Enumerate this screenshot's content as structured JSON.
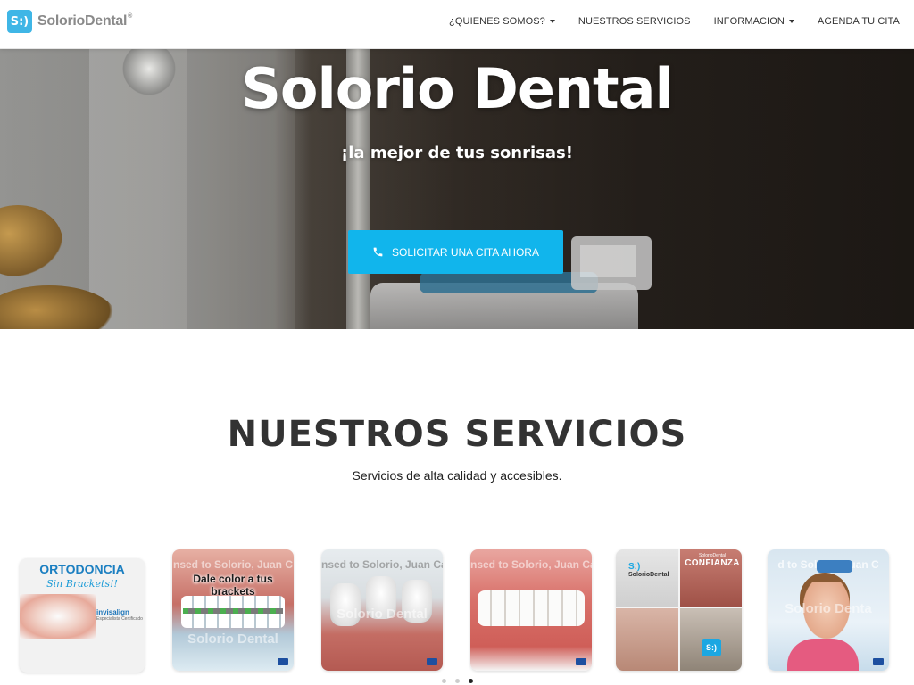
{
  "brand": {
    "mark": "S:)",
    "name": "SolorioDental",
    "trademark": "®"
  },
  "nav": {
    "items": [
      {
        "label": "¿QUIENES SOMOS?",
        "dropdown": true
      },
      {
        "label": "NUESTROS SERVICIOS",
        "dropdown": false
      },
      {
        "label": "INFORMACION",
        "dropdown": true
      },
      {
        "label": "AGENDA TU CITA",
        "dropdown": false
      }
    ]
  },
  "hero": {
    "title": "Solorio Dental",
    "subtitle": "¡la mejor de tus sonrisas!",
    "cta_label": "SOLICITAR UNA CITA AHORA",
    "cta_icon": "phone-icon"
  },
  "services": {
    "title": "NUESTROS SERVICIOS",
    "subtitle": "Servicios de alta calidad y accesibles.",
    "cards": [
      {
        "headline": "ORTODONCIA",
        "tagline": "Sin Brackets!!",
        "brand": "invisalign",
        "brand_sub": "Especialista Certificado"
      },
      {
        "headline": "Dale color a tus brackets",
        "watermark_top": "nsed to Solorio, Juan C",
        "watermark_mid": "Solorio Dental"
      },
      {
        "watermark_top": "nsed to Solorio, Juan Ca",
        "watermark_mid": "Solorio Dental"
      },
      {
        "watermark_top": "nsed to Solorio, Juan Ca"
      },
      {
        "logo": "SolorioDental",
        "logo_mark": "S:)",
        "headline": "CONFIANZA",
        "brand_small": "SolorioDental",
        "badge": "S:)"
      },
      {
        "watermark_top": "d to Solorio, Juan C",
        "watermark_mid": "Solorio Denta"
      }
    ]
  },
  "carousel": {
    "dot_count": 3,
    "active_index": 2
  },
  "colors": {
    "accent": "#11b5ec",
    "brand": "#3fb6e6",
    "heading": "#333333"
  }
}
